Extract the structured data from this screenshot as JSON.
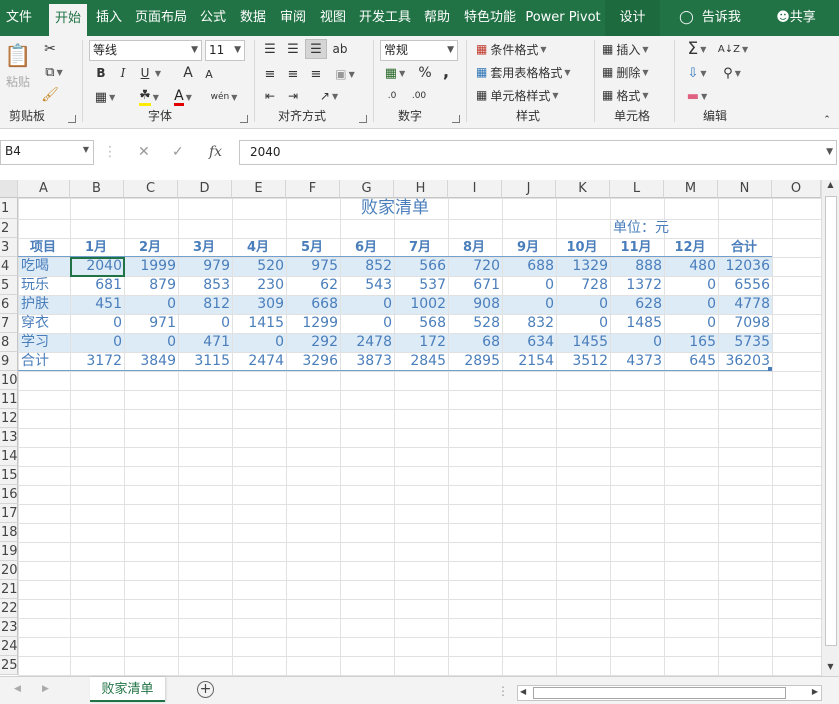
{
  "ribbon_tabs": [
    "文件",
    "开始",
    "插入",
    "页面布局",
    "公式",
    "数据",
    "审阅",
    "视图",
    "开发工具",
    "帮助",
    "特色功能",
    "Power Pivot",
    "设计"
  ],
  "tell_me": "告诉我",
  "share": "共享",
  "clipboard": {
    "paste": "粘贴",
    "group": "剪贴板"
  },
  "font": {
    "name": "等线",
    "size": "11",
    "group": "字体",
    "bold": "B",
    "italic": "I",
    "underline": "U",
    "grow": "A",
    "shrink": "A",
    "wen": "wén"
  },
  "align": {
    "group": "对齐方式"
  },
  "number": {
    "format": "常规",
    "group": "数字",
    "percent": "%",
    "comma": ","
  },
  "styles": {
    "cond": "条件格式",
    "table": "套用表格格式",
    "cell": "单元格样式",
    "group": "样式"
  },
  "cells": {
    "insert": "插入",
    "delete": "删除",
    "format": "格式",
    "group": "单元格"
  },
  "edit": {
    "group": "编辑"
  },
  "formula_bar": {
    "name_box": "B4",
    "formula": "2040",
    "fx": "fx"
  },
  "columns": [
    "A",
    "B",
    "C",
    "D",
    "E",
    "F",
    "G",
    "H",
    "I",
    "J",
    "K",
    "L",
    "M",
    "N",
    "O"
  ],
  "rows": [
    "1",
    "2",
    "3",
    "4",
    "5",
    "6",
    "7",
    "8",
    "9",
    "10",
    "11",
    "12",
    "13",
    "14",
    "15",
    "16",
    "17",
    "18",
    "19",
    "20",
    "21",
    "22",
    "23",
    "24",
    "25"
  ],
  "sheet": {
    "title": "败家清单",
    "unit": "单位：元",
    "headers": [
      "项目",
      "1月",
      "2月",
      "3月",
      "4月",
      "5月",
      "6月",
      "7月",
      "8月",
      "9月",
      "10月",
      "11月",
      "12月",
      "合计"
    ],
    "data": [
      [
        "吃喝",
        "2040",
        "1999",
        "979",
        "520",
        "975",
        "852",
        "566",
        "720",
        "688",
        "1329",
        "888",
        "480",
        "12036"
      ],
      [
        "玩乐",
        "681",
        "879",
        "853",
        "230",
        "62",
        "543",
        "537",
        "671",
        "0",
        "728",
        "1372",
        "0",
        "6556"
      ],
      [
        "护肤",
        "451",
        "0",
        "812",
        "309",
        "668",
        "0",
        "1002",
        "908",
        "0",
        "0",
        "628",
        "0",
        "4778"
      ],
      [
        "穿衣",
        "0",
        "971",
        "0",
        "1415",
        "1299",
        "0",
        "568",
        "528",
        "832",
        "0",
        "1485",
        "0",
        "7098"
      ],
      [
        "学习",
        "0",
        "0",
        "471",
        "0",
        "292",
        "2478",
        "172",
        "68",
        "634",
        "1455",
        "0",
        "165",
        "5735"
      ],
      [
        "合计",
        "3172",
        "3849",
        "3115",
        "2474",
        "3296",
        "3873",
        "2845",
        "2895",
        "2154",
        "3512",
        "4373",
        "645",
        "36203"
      ]
    ]
  },
  "sheet_tab": "败家清单",
  "colors": {
    "accent": "#217346",
    "cell_text": "#4a7ebb",
    "band": "#ddebf7"
  }
}
